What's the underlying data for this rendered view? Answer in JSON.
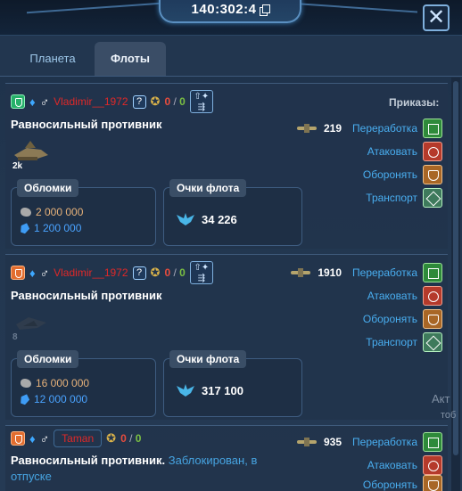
{
  "header": {
    "coordinates": "140:302:4",
    "close_glyph": "✕"
  },
  "tabs": [
    {
      "label": "Планета"
    },
    {
      "label": "Флоты"
    }
  ],
  "orders_title": "Приказы:",
  "fleets": [
    {
      "player": "Vladimir__1972",
      "question": "?",
      "score_a": "0",
      "score_sep": "/",
      "score_b": "0",
      "opponent": "Равносильный противник",
      "ship_count": "2k",
      "debris_label": "Обломки",
      "metal": "2 000 000",
      "crystal": "1 200 000",
      "points_label": "Очки флота",
      "points": "34 226",
      "fleet_size": "219",
      "orders": [
        "Переработка",
        "Атаковать",
        "Оборонять",
        "Транспорт"
      ]
    },
    {
      "player": "Vladimir__1972",
      "question": "?",
      "score_a": "0",
      "score_sep": "/",
      "score_b": "0",
      "opponent": "Равносильный противник",
      "ship_count": "8",
      "debris_label": "Обломки",
      "metal": "16 000 000",
      "crystal": "12 000 000",
      "points_label": "Очки флота",
      "points": "317 100",
      "fleet_size": "1910",
      "orders": [
        "Переработка",
        "Атаковать",
        "Оборонять",
        "Транспорт"
      ]
    },
    {
      "player": "Taman",
      "score_a": "0",
      "score_sep": "/",
      "score_b": "0",
      "opponent": "Равносильный противник.",
      "blocked": "Заблокирован, в отпуске",
      "fleet_size": "935",
      "orders": [
        "Переработка",
        "Атаковать",
        "Оборонять"
      ]
    }
  ],
  "side_text": {
    "line1": "Акт",
    "line2": "тоб"
  },
  "colors": {
    "accent": "#49aef0",
    "enemy_name": "#e02828",
    "metal": "#e7b27a",
    "crystal": "#4aa3ff"
  }
}
